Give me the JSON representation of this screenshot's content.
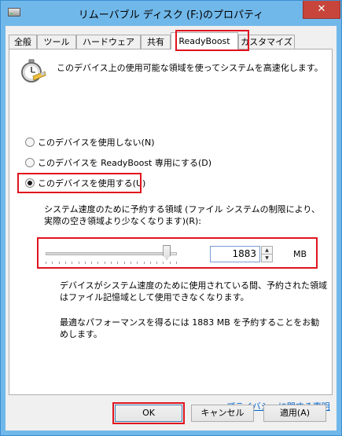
{
  "window": {
    "title": "リムーバブル ディスク (F:)のプロパティ",
    "close_glyph": "✕"
  },
  "tabs": [
    {
      "label": "全般",
      "selected": false
    },
    {
      "label": "ツール",
      "selected": false
    },
    {
      "label": "ハードウェア",
      "selected": false
    },
    {
      "label": "共有",
      "selected": false
    },
    {
      "label": "ReadyBoost",
      "selected": true
    },
    {
      "label": "カスタマイズ",
      "selected": false
    }
  ],
  "readyboost": {
    "icon": "readyboost-stopwatch-icon",
    "description": "このデバイス上の使用可能な領域を使ってシステムを高速化します。",
    "options": [
      {
        "label": "このデバイスを使用しない(N)",
        "checked": false
      },
      {
        "label": "このデバイスを ReadyBoost 専用にする(D)",
        "checked": false
      },
      {
        "label": "このデバイスを使用する(U)",
        "checked": true
      }
    ],
    "reserve_label": "システム速度のために予約する領域 (ファイル システムの制限により、実際の空き領域より少なくなります)(R):",
    "slider_fraction": 0.95,
    "reserve_value": "1883",
    "unit": "MB",
    "note_in_use": "デバイスがシステム速度のために使用されている間、予約された領域はファイル記憶域として使用できなくなります。",
    "note_recommend": "最適なパフォーマンスを得るには 1883 MB を予約することをお勧めします。",
    "privacy_link": "プライバシーに関する声明"
  },
  "buttons": {
    "ok": "OK",
    "cancel": "キャンセル",
    "apply": "適用(A)"
  },
  "colors": {
    "highlight": "#e0141e",
    "close": "#c7453b",
    "link": "#0066cc",
    "frame": "#71b8ea"
  }
}
